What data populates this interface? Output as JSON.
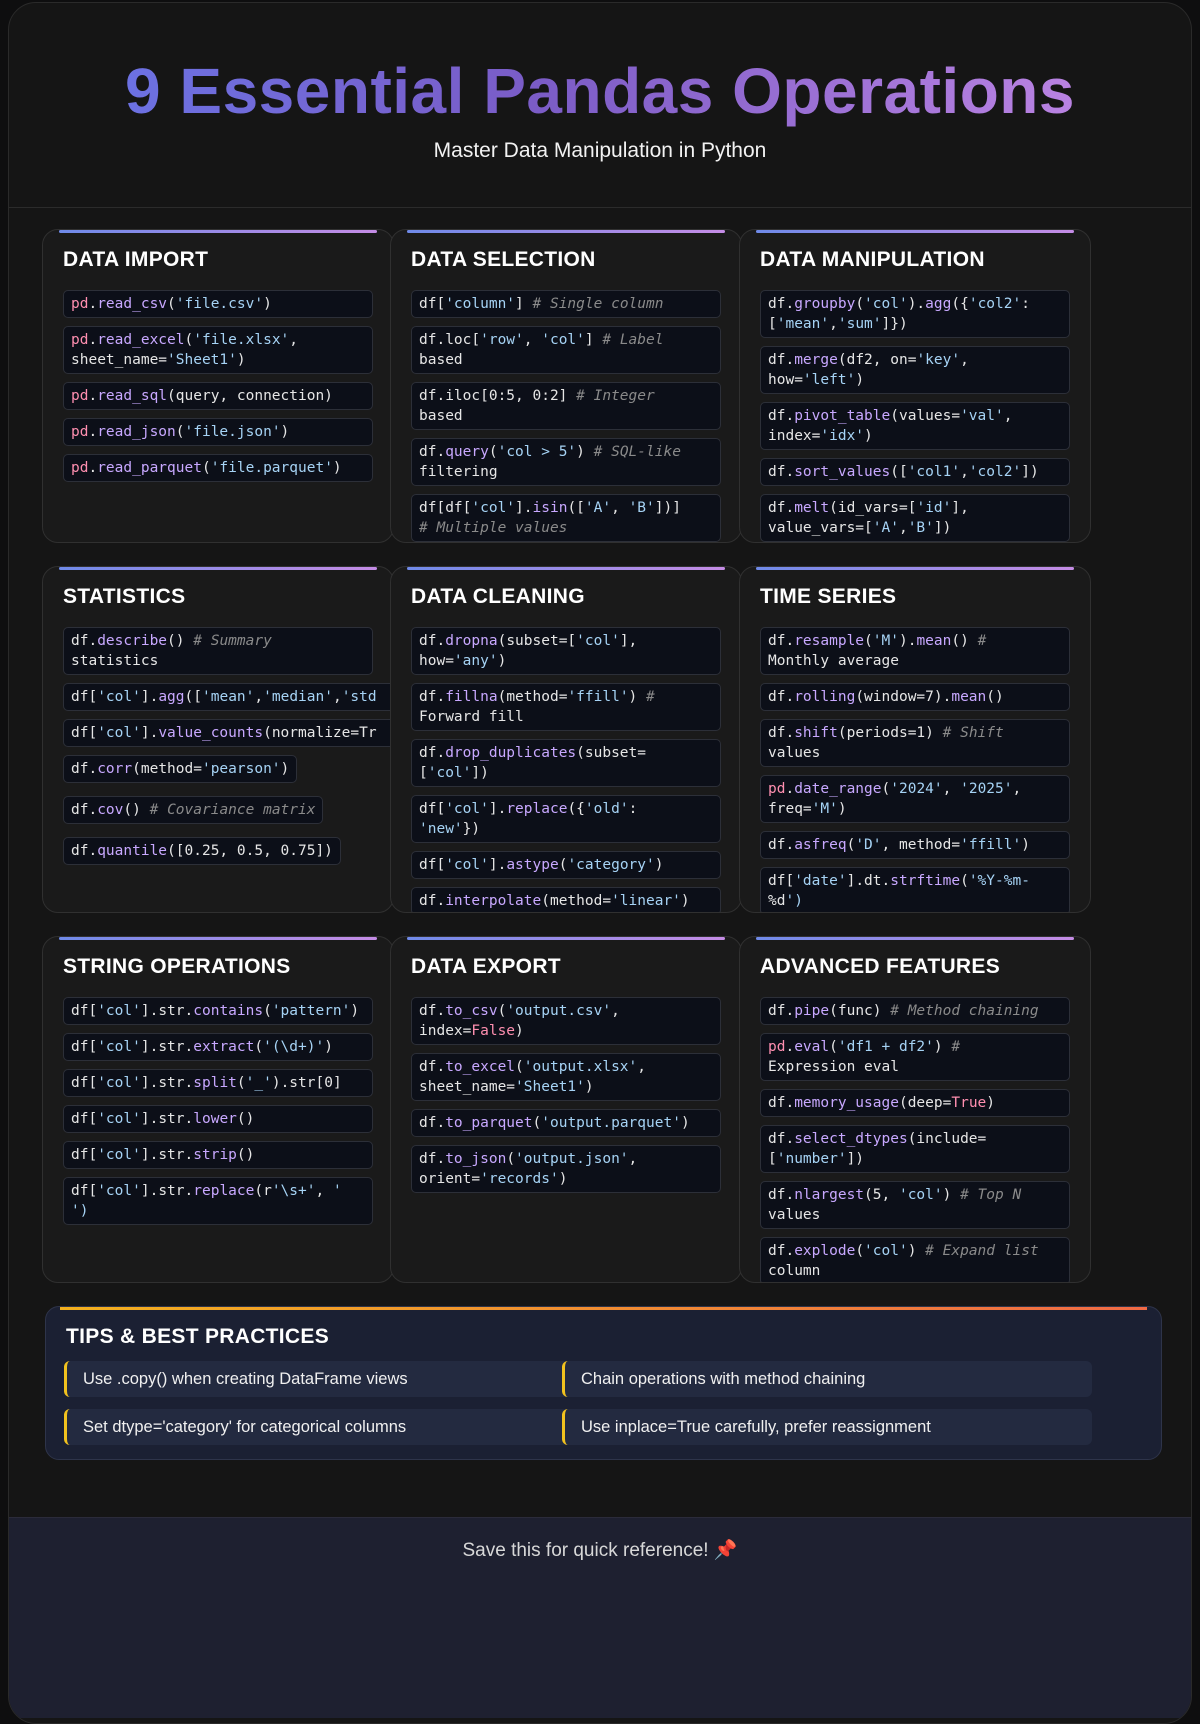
{
  "header": {
    "title": "9 Essential Pandas Operations",
    "subtitle": "Master Data Manipulation in Python"
  },
  "cards": [
    {
      "title": "DATA IMPORT",
      "snippets": [
        "pd.read_csv('file.csv')",
        "pd.read_excel('file.xlsx',\nsheet_name='Sheet1')",
        "pd.read_sql(query, connection)",
        "pd.read_json('file.json')",
        "pd.read_parquet('file.parquet')"
      ]
    },
    {
      "title": "DATA SELECTION",
      "snippets": [
        "df['column'] # Single column",
        "df.loc['row', 'col'] # Label\nbased",
        "df.iloc[0:5, 0:2] # Integer\nbased",
        "df.query('col > 5') # SQL-like\nfiltering",
        "df[df['col'].isin(['A', 'B'])]\n# Multiple values"
      ]
    },
    {
      "title": "DATA MANIPULATION",
      "snippets": [
        "df.groupby('col').agg({'col2':\n['mean','sum']})",
        "df.merge(df2, on='key',\nhow='left')",
        "df.pivot_table(values='val',\nindex='idx')",
        "df.sort_values(['col1','col2'])",
        "df.melt(id_vars=['id'],\nvalue_vars=['A','B'])"
      ]
    },
    {
      "title": "STATISTICS",
      "snippets": [
        "df.describe() # Summary\nstatistics",
        "df['col'].agg(['mean','median','std",
        "df['col'].value_counts(normalize=Tr",
        "df.corr(method='pearson')",
        "df.cov() # Covariance matrix",
        "df.quantile([0.25, 0.5, 0.75])"
      ]
    },
    {
      "title": "DATA CLEANING",
      "snippets": [
        "df.dropna(subset=['col'],\nhow='any')",
        "df.fillna(method='ffill') #\nForward fill",
        "df.drop_duplicates(subset=\n['col'])",
        "df['col'].replace({'old':\n'new'})",
        "df['col'].astype('category')",
        "df.interpolate(method='linear')"
      ]
    },
    {
      "title": "TIME SERIES",
      "snippets": [
        "df.resample('M').mean() #\nMonthly average",
        "df.rolling(window=7).mean()",
        "df.shift(periods=1) # Shift\nvalues",
        "pd.date_range('2024', '2025',\nfreq='M')",
        "df.asfreq('D', method='ffill')",
        "df['date'].dt.strftime('%Y-%m-\n%d')"
      ]
    },
    {
      "title": "STRING OPERATIONS",
      "snippets": [
        "df['col'].str.contains('pattern')",
        "df['col'].str.extract('(\\d+)')",
        "df['col'].str.split('_').str[0]",
        "df['col'].str.lower()",
        "df['col'].str.strip()",
        "df['col'].str.replace(r'\\s+', '\n')"
      ]
    },
    {
      "title": "DATA EXPORT",
      "snippets": [
        "df.to_csv('output.csv',\nindex=False)",
        "df.to_excel('output.xlsx',\nsheet_name='Sheet1')",
        "df.to_parquet('output.parquet')",
        "df.to_json('output.json',\norient='records')"
      ]
    },
    {
      "title": "ADVANCED FEATURES",
      "snippets": [
        "df.pipe(func) # Method chaining",
        "pd.eval('df1 + df2') #\nExpression eval",
        "df.memory_usage(deep=True)",
        "df.select_dtypes(include=\n['number'])",
        "df.nlargest(5, 'col') # Top N\nvalues",
        "df.explode('col') # Expand list\ncolumn"
      ]
    }
  ],
  "tips": {
    "title": "TIPS & BEST PRACTICES",
    "items": [
      "Use .copy() when creating DataFrame views",
      "Chain operations with method chaining",
      "Set dtype='category' for categorical columns",
      "Use inplace=True carefully, prefer reassignment"
    ]
  },
  "footer": {
    "text": "Save this for quick reference!",
    "icon": "pushpin-icon"
  }
}
